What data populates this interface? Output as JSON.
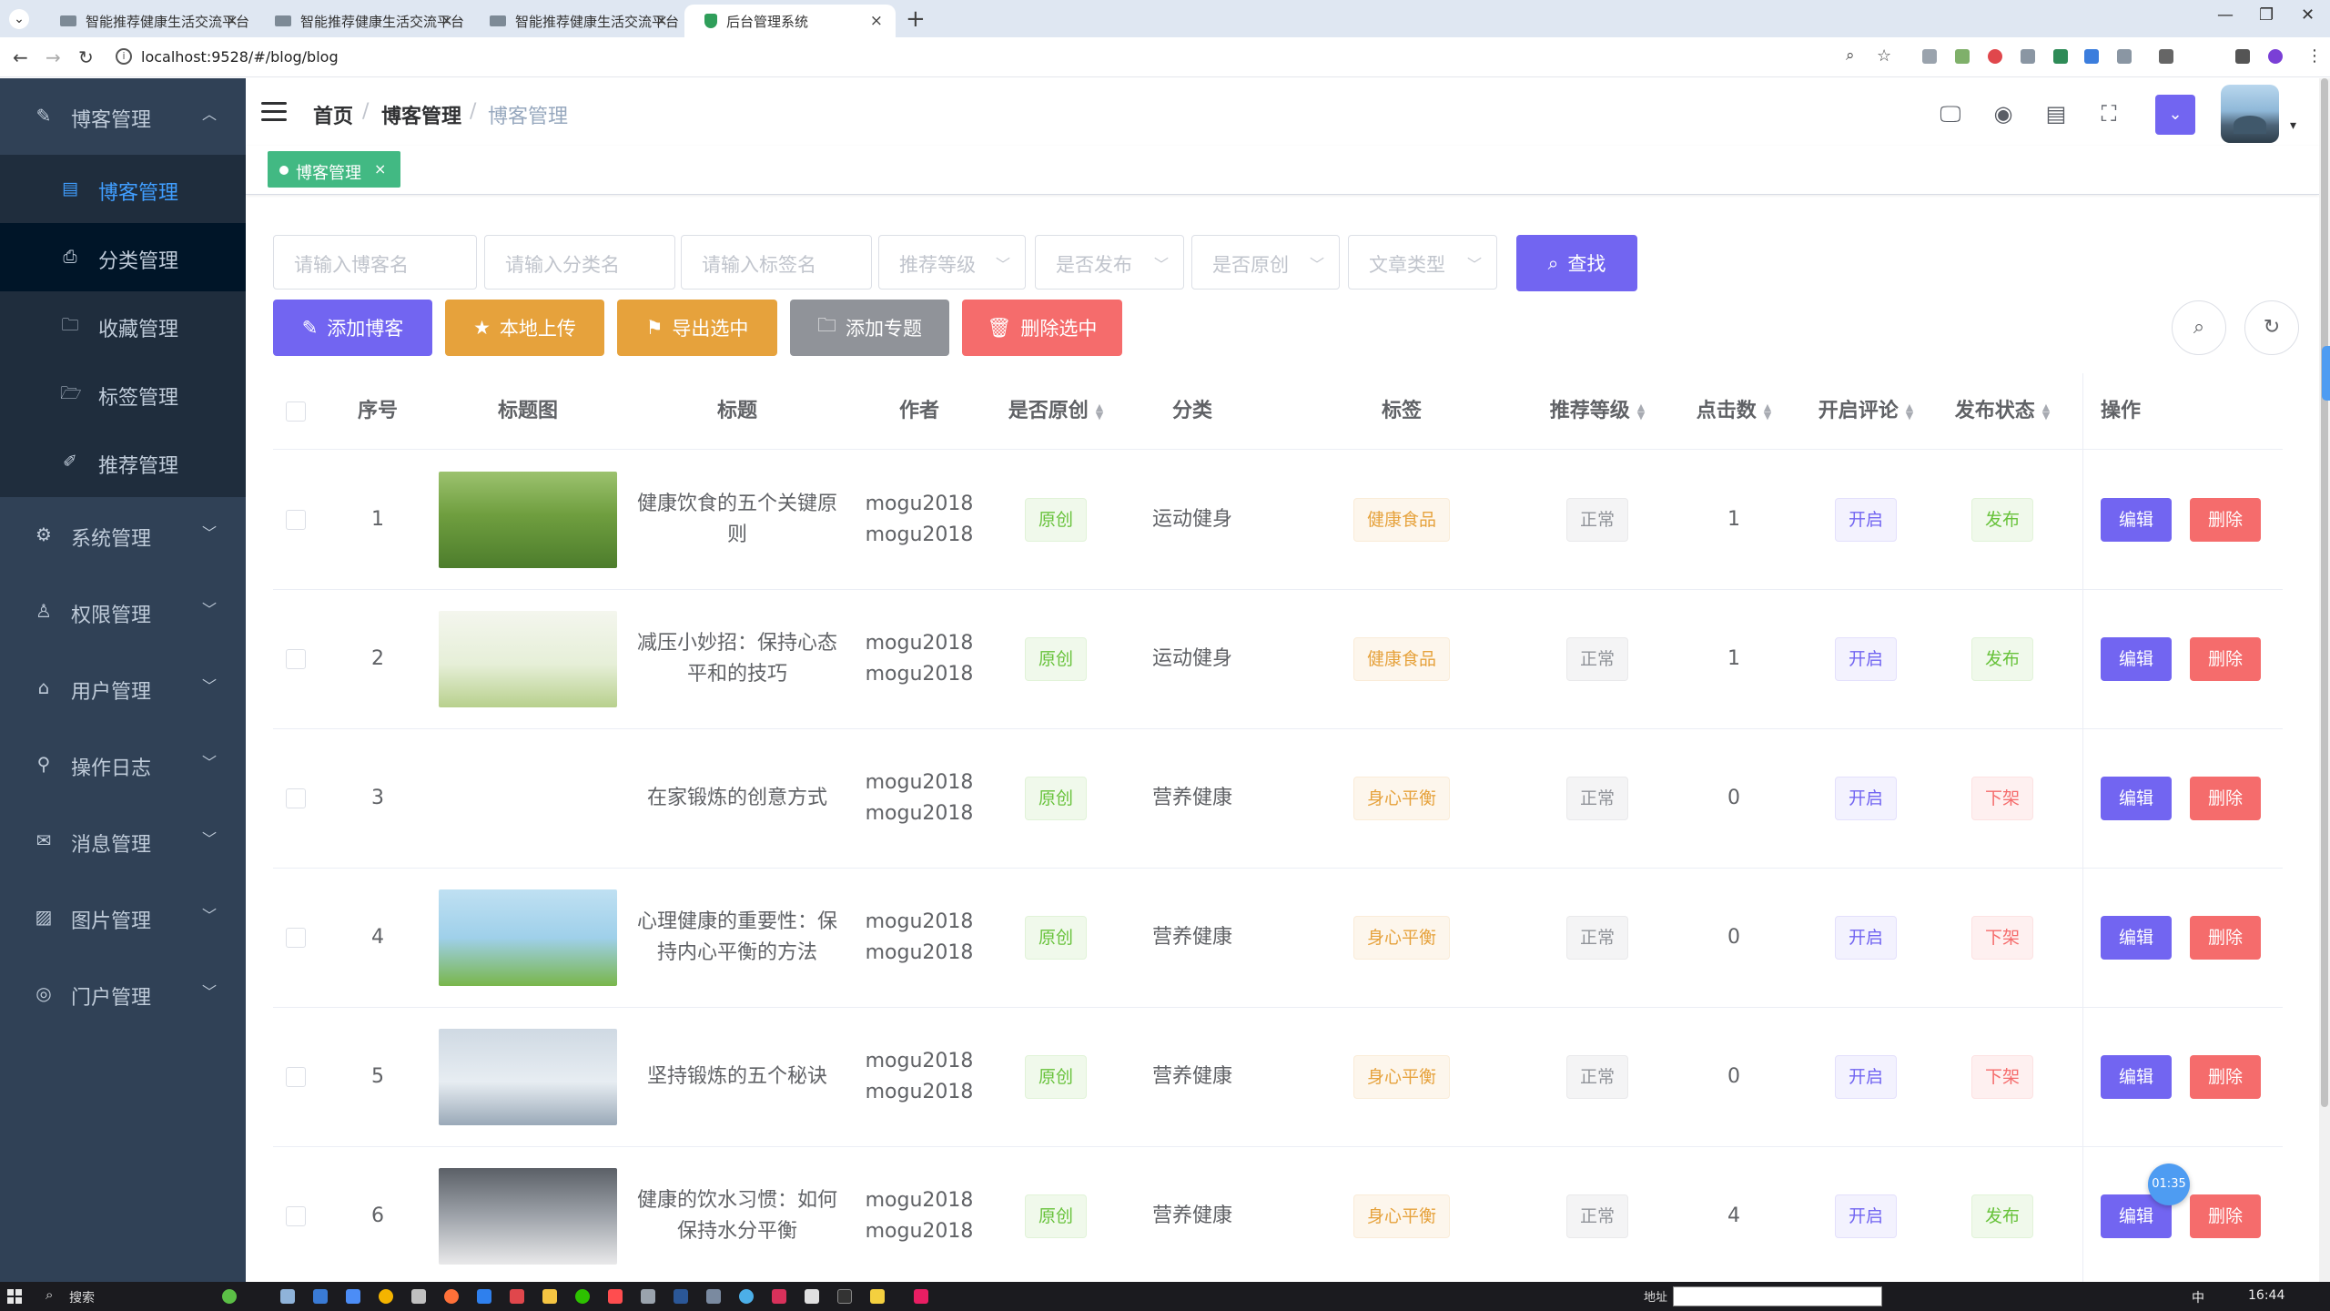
{
  "browser": {
    "tabs": [
      {
        "title": "智能推荐健康生活交流平台",
        "active": false
      },
      {
        "title": "智能推荐健康生活交流平台",
        "active": false
      },
      {
        "title": "智能推荐健康生活交流平台",
        "active": false
      },
      {
        "title": "后台管理系统",
        "active": true
      }
    ],
    "url": "localhost:9528/#/blog/blog"
  },
  "sidebar": {
    "top": {
      "label": "博客管理",
      "icon": "edit-icon"
    },
    "subitems": [
      {
        "label": "博客管理",
        "icon": "document-icon",
        "state": "active"
      },
      {
        "label": "分类管理",
        "icon": "printer-icon",
        "state": "hover"
      },
      {
        "label": "收藏管理",
        "icon": "folder-icon",
        "state": ""
      },
      {
        "label": "标签管理",
        "icon": "folder-open-icon",
        "state": ""
      },
      {
        "label": "推荐管理",
        "icon": "pen-icon",
        "state": ""
      }
    ],
    "items": [
      {
        "label": "系统管理",
        "icon": "gear-icon"
      },
      {
        "label": "权限管理",
        "icon": "user-icon"
      },
      {
        "label": "用户管理",
        "icon": "home-icon"
      },
      {
        "label": "操作日志",
        "icon": "paperclip-icon"
      },
      {
        "label": "消息管理",
        "icon": "mail-icon"
      },
      {
        "label": "图片管理",
        "icon": "image-icon"
      },
      {
        "label": "门户管理",
        "icon": "globe-icon"
      }
    ]
  },
  "breadcrumb": {
    "home": "首页",
    "level1": "博客管理",
    "current": "博客管理",
    "sep": "/"
  },
  "tagsview": {
    "active_tag": "博客管理",
    "close": "×"
  },
  "search": {
    "blog_name_placeholder": "请输入博客名",
    "sort_name_placeholder": "请输入分类名",
    "tag_name_placeholder": "请输入标签名",
    "level_placeholder": "推荐等级",
    "publish_placeholder": "是否发布",
    "original_placeholder": "是否原创",
    "article_type_placeholder": "文章类型",
    "search_button": "查找"
  },
  "toolbar": {
    "add_blog": "添加博客",
    "local_upload": "本地上传",
    "export_selected": "导出选中",
    "add_subject": "添加专题",
    "delete_selected": "删除选中"
  },
  "table": {
    "headers": {
      "index": "序号",
      "image": "标题图",
      "title": "标题",
      "author": "作者",
      "original": "是否原创",
      "sort": "分类",
      "tag": "标签",
      "level": "推荐等级",
      "clicks": "点击数",
      "comment": "开启评论",
      "status": "发布状态",
      "ops": "操作"
    },
    "edit_label": "编辑",
    "delete_label": "删除",
    "rows": [
      {
        "index": "1",
        "title": "健康饮食的五个关键原则",
        "author": "mogu2018mogu2018",
        "original": "原创",
        "sort": "运动健身",
        "tag": "健康食品",
        "level": "正常",
        "clicks": "1",
        "comment": "开启",
        "status": "发布",
        "image": "runners-photo"
      },
      {
        "index": "2",
        "title": "减压小妙招：保持心态平和的技巧",
        "author": "mogu2018mogu2018",
        "original": "原创",
        "sort": "运动健身",
        "tag": "健康食品",
        "level": "正常",
        "clicks": "1",
        "comment": "开启",
        "status": "发布",
        "image": "park-illustration"
      },
      {
        "index": "3",
        "title": "在家锻炼的创意方式",
        "author": "mogu2018mogu2018",
        "original": "原创",
        "sort": "营养健康",
        "tag": "身心平衡",
        "level": "正常",
        "clicks": "0",
        "comment": "开启",
        "status": "下架",
        "image": "campaign-logo"
      },
      {
        "index": "4",
        "title": "心理健康的重要性：保持内心平衡的方法",
        "author": "mogu2018mogu2018",
        "original": "原创",
        "sort": "营养健康",
        "tag": "身心平衡",
        "level": "正常",
        "clicks": "0",
        "comment": "开启",
        "status": "下架",
        "image": "balloons-photo"
      },
      {
        "index": "5",
        "title": "坚持锻炼的五个秘诀",
        "author": "mogu2018mogu2018",
        "original": "原创",
        "sort": "营养健康",
        "tag": "身心平衡",
        "level": "正常",
        "clicks": "0",
        "comment": "开启",
        "status": "下架",
        "image": "jogger-photo"
      },
      {
        "index": "6",
        "title": "健康的饮水习惯：如何保持水分平衡",
        "author": "mogu2018mogu2018",
        "original": "原创",
        "sort": "营养健康",
        "tag": "身心平衡",
        "level": "正常",
        "clicks": "4",
        "comment": "开启",
        "status": "发布",
        "image": "sleeping-photo"
      }
    ]
  },
  "floating_timer": "01:35",
  "taskbar": {
    "search": "搜索",
    "address_label": "地址",
    "lang": "中",
    "time": "16:44"
  },
  "colors": {
    "sidebar_bg": "#304156",
    "submenu_bg": "#1f2d3d",
    "active_blue": "#409eff",
    "primary_purple": "#7265f1",
    "tag_green": "#42b983"
  }
}
